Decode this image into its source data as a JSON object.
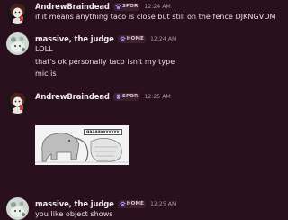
{
  "messages": [
    {
      "username": "AndrewBraindead",
      "tag": "SPOR",
      "tag_icon": "paw-icon",
      "timestamp": "12:24 AM",
      "lines": [
        "if it means anything taco is close but still on the fence DJKNGVDM"
      ]
    },
    {
      "username": "massive, the judge",
      "tag": "HOME",
      "tag_icon": "paw-icon",
      "timestamp": "12:24 AM",
      "lines": [
        "LOLL",
        "that's ok personally taco isn't my type",
        "mic is"
      ]
    },
    {
      "username": "AndrewBraindead",
      "tag": "SPOR",
      "tag_icon": "paw-icon",
      "timestamp": "12:25 AM",
      "lines": [],
      "attachment": {
        "caption": "gaaaayyyyyyy",
        "type": "meme-image"
      }
    },
    {
      "username": "massive, the judge",
      "tag": "HOME",
      "tag_icon": "paw-icon",
      "timestamp": "12:25 AM",
      "lines": [
        "you like object shows"
      ]
    }
  ],
  "colors": {
    "background": "#2a0f1c",
    "username": "#f2eaec",
    "text": "#e9dfe3",
    "timestamp": "#a99aa2",
    "tag_background": "#3d1f2d",
    "tag_icon": "#a78bfa"
  }
}
